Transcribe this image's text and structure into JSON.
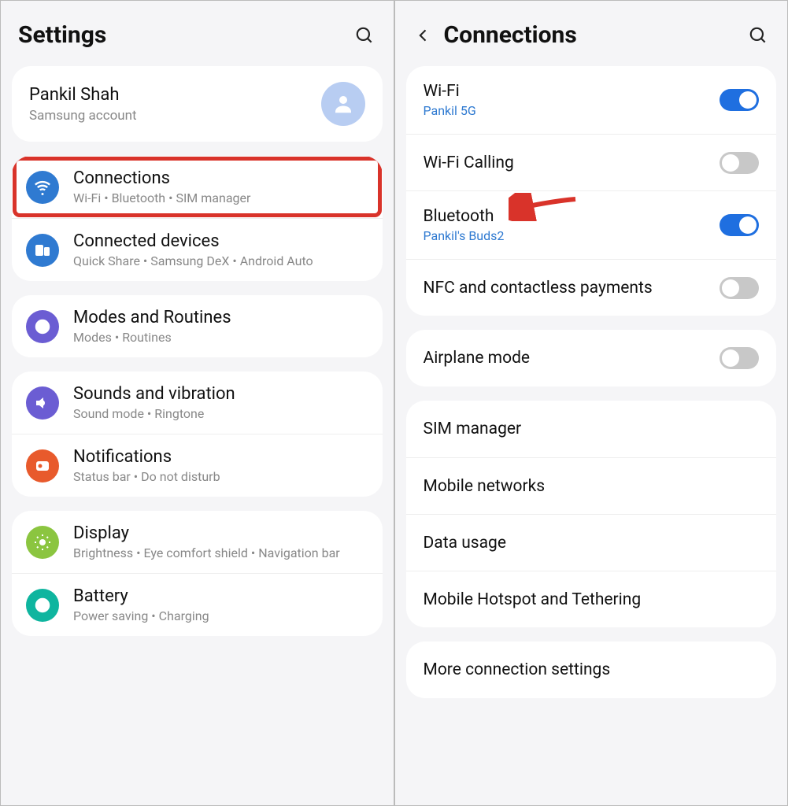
{
  "left": {
    "title": "Settings",
    "account": {
      "name": "Pankil Shah",
      "sub": "Samsung account"
    },
    "groups": [
      {
        "items": [
          {
            "icon": "wifi",
            "color": "#2f7ad1",
            "title": "Connections",
            "sub": "Wi-Fi  •  Bluetooth  •  SIM manager",
            "highlight": true
          },
          {
            "icon": "devices",
            "color": "#2f7ad1",
            "title": "Connected devices",
            "sub": "Quick Share  •  Samsung DeX  •  Android Auto"
          }
        ]
      },
      {
        "items": [
          {
            "icon": "routines",
            "color": "#6b5dd3",
            "title": "Modes and Routines",
            "sub": "Modes  •  Routines"
          }
        ]
      },
      {
        "items": [
          {
            "icon": "sound",
            "color": "#6b5dd3",
            "title": "Sounds and vibration",
            "sub": "Sound mode  •  Ringtone"
          },
          {
            "icon": "notif",
            "color": "#e85a2c",
            "title": "Notifications",
            "sub": "Status bar  •  Do not disturb"
          }
        ]
      },
      {
        "items": [
          {
            "icon": "display",
            "color": "#8bc540",
            "title": "Display",
            "sub": "Brightness  •  Eye comfort shield  •  Navigation bar"
          },
          {
            "icon": "battery",
            "color": "#0fb59f",
            "title": "Battery",
            "sub": "Power saving  •  Charging"
          }
        ]
      }
    ]
  },
  "right": {
    "title": "Connections",
    "groups": [
      {
        "items": [
          {
            "title": "Wi-Fi",
            "sub": "Pankil 5G",
            "toggle": true
          },
          {
            "title": "Wi-Fi Calling",
            "toggle": false
          },
          {
            "title": "Bluetooth",
            "sub": "Pankil's Buds2",
            "toggle": true,
            "arrow": true
          },
          {
            "title": "NFC and contactless payments",
            "toggle": false
          }
        ]
      },
      {
        "items": [
          {
            "title": "Airplane mode",
            "toggle": false
          }
        ]
      },
      {
        "items": [
          {
            "title": "SIM manager"
          },
          {
            "title": "Mobile networks"
          },
          {
            "title": "Data usage"
          },
          {
            "title": "Mobile Hotspot and Tethering"
          }
        ]
      },
      {
        "items": [
          {
            "title": "More connection settings"
          }
        ]
      }
    ]
  }
}
